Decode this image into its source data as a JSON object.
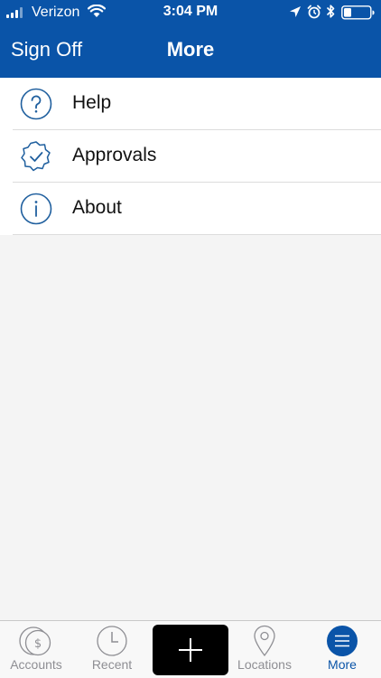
{
  "status_bar": {
    "carrier": "Verizon",
    "time": "3:04 PM",
    "icons": [
      "signal-icon",
      "wifi-icon",
      "location-arrow-icon",
      "alarm-icon",
      "bluetooth-icon",
      "battery-icon"
    ]
  },
  "nav": {
    "left_button": "Sign Off",
    "title": "More",
    "bar_color": "#0a54a8"
  },
  "menu": {
    "items": [
      {
        "label": "Help",
        "icon": "help-icon"
      },
      {
        "label": "Approvals",
        "icon": "approvals-check-badge-icon"
      },
      {
        "label": "About",
        "icon": "info-icon"
      }
    ]
  },
  "tab_bar": {
    "tabs": [
      {
        "label": "Accounts",
        "icon": "accounts-dollar-icon",
        "active": false
      },
      {
        "label": "Recent",
        "icon": "clock-icon",
        "active": false
      },
      {
        "label": "",
        "icon": "plus-icon",
        "active": false
      },
      {
        "label": "Locations",
        "icon": "location-pin-icon",
        "active": false
      },
      {
        "label": "More",
        "icon": "hamburger-menu-icon",
        "active": true
      }
    ],
    "active_color": "#0a54a8",
    "inactive_color": "#8e8e93"
  }
}
